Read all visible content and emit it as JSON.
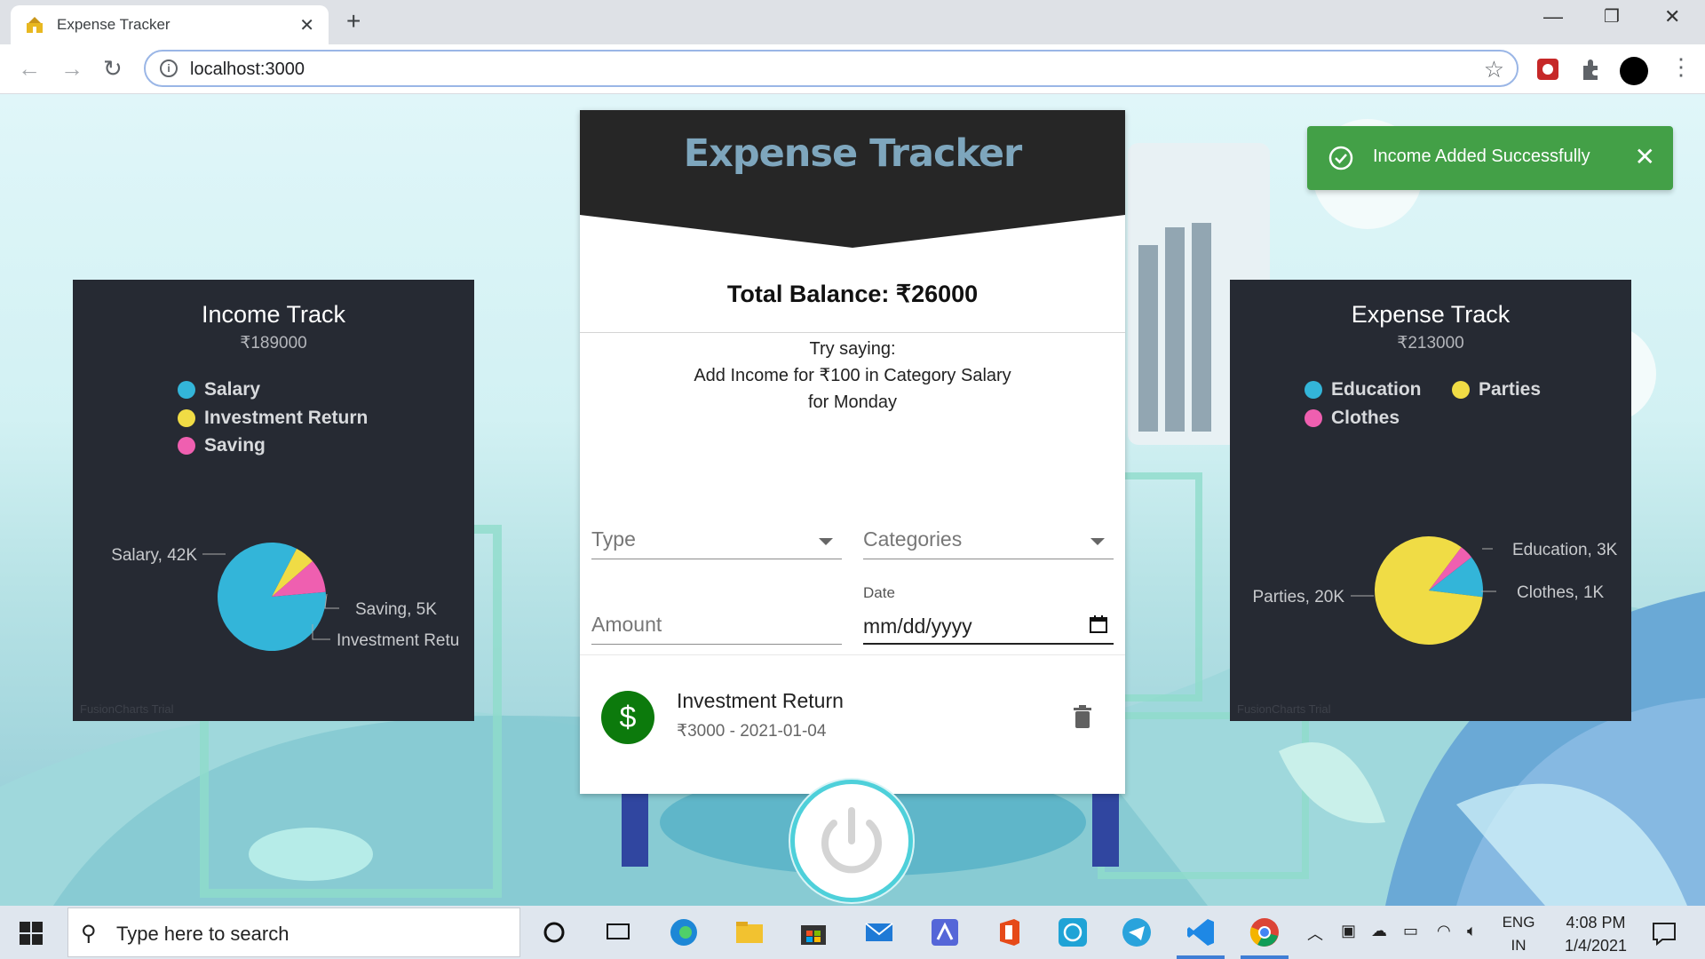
{
  "browser": {
    "tab_title": "Expense Tracker",
    "url": "localhost:3000"
  },
  "app": {
    "title": "Expense Tracker",
    "balance_label": "Total Balance: ₹26000",
    "hint_line1": "Try saying:",
    "hint_line2": "Add Income for ₹100 in Category Salary",
    "hint_line3": "for Monday",
    "type_label": "Type",
    "categories_label": "Categories",
    "amount_label": "Amount",
    "date_caption": "Date",
    "date_placeholder": "mm/dd/yyyy",
    "transactions": [
      {
        "name": "Investment Return",
        "detail": "₹3000 - 2021-01-04",
        "icon": "dollar-icon",
        "color": "#0c7a0c"
      }
    ]
  },
  "toast": {
    "message": "Income Added Successfully",
    "color": "#43a047"
  },
  "income_chart": {
    "title": "Income Track",
    "total": "₹189000",
    "legend": [
      "Salary",
      "Investment Return",
      "Saving"
    ],
    "labels": [
      "Salary, 42K",
      "Saving, 5K",
      "Investment Retu"
    ],
    "trial": "FusionCharts Trial"
  },
  "expense_chart": {
    "title": "Expense Track",
    "total": "₹213000",
    "legend": [
      "Education",
      "Parties",
      "Clothes"
    ],
    "labels": [
      "Education, 3K",
      "Parties, 20K",
      "Clothes, 1K"
    ],
    "trial": "FusionCharts Trial"
  },
  "chart_data": [
    {
      "type": "pie",
      "title": "Income Track",
      "subtitle": "₹189000",
      "categories": [
        "Salary",
        "Investment Return",
        "Saving"
      ],
      "values": [
        42000,
        3000,
        5000
      ],
      "colors": [
        "#33b5d9",
        "#f0dc45",
        "#ef5fb0"
      ]
    },
    {
      "type": "pie",
      "title": "Expense Track",
      "subtitle": "₹213000",
      "categories": [
        "Education",
        "Parties",
        "Clothes"
      ],
      "values": [
        3000,
        20000,
        1000
      ],
      "colors": [
        "#33b5d9",
        "#f0dc45",
        "#ef5fb0"
      ]
    }
  ],
  "taskbar": {
    "search_placeholder": "Type here to search",
    "lang_line1": "ENG",
    "lang_line2": "IN",
    "time": "4:08 PM",
    "date": "1/4/2021"
  }
}
